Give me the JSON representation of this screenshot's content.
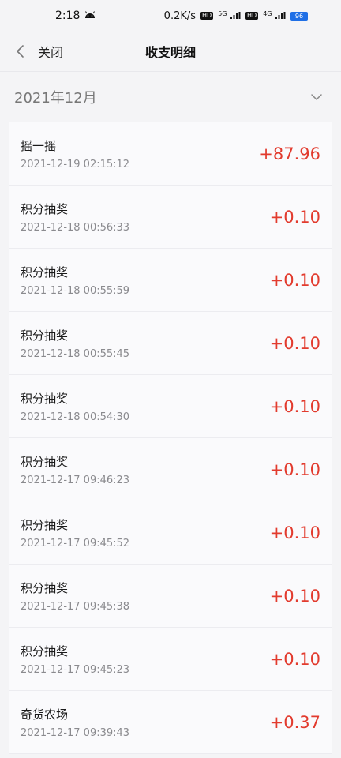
{
  "status_bar": {
    "time": "2:18",
    "android_icon": "android-icon",
    "speed": "0.2K/s",
    "hd1": "HD",
    "net1": "5G",
    "hd2": "HD",
    "net2": "4G",
    "battery": "96"
  },
  "header": {
    "back_icon": "chevron-left-icon",
    "close_label": "关闭",
    "title": "收支明细"
  },
  "month": {
    "label": "2021年12月",
    "expand_icon": "chevron-down-icon"
  },
  "transactions": [
    {
      "name": "摇一摇",
      "time": "2021-12-19 02:15:12",
      "amount": "+87.96"
    },
    {
      "name": "积分抽奖",
      "time": "2021-12-18 00:56:33",
      "amount": "+0.10"
    },
    {
      "name": "积分抽奖",
      "time": "2021-12-18 00:55:59",
      "amount": "+0.10"
    },
    {
      "name": "积分抽奖",
      "time": "2021-12-18 00:55:45",
      "amount": "+0.10"
    },
    {
      "name": "积分抽奖",
      "time": "2021-12-18 00:54:30",
      "amount": "+0.10"
    },
    {
      "name": "积分抽奖",
      "time": "2021-12-17 09:46:23",
      "amount": "+0.10"
    },
    {
      "name": "积分抽奖",
      "time": "2021-12-17 09:45:52",
      "amount": "+0.10"
    },
    {
      "name": "积分抽奖",
      "time": "2021-12-17 09:45:38",
      "amount": "+0.10"
    },
    {
      "name": "积分抽奖",
      "time": "2021-12-17 09:45:23",
      "amount": "+0.10"
    },
    {
      "name": "奇货农场",
      "time": "2021-12-17 09:39:43",
      "amount": "+0.37"
    }
  ],
  "colors": {
    "amount": "#e23b2e",
    "background": "#f4f4f6",
    "card": "#fafafc"
  }
}
